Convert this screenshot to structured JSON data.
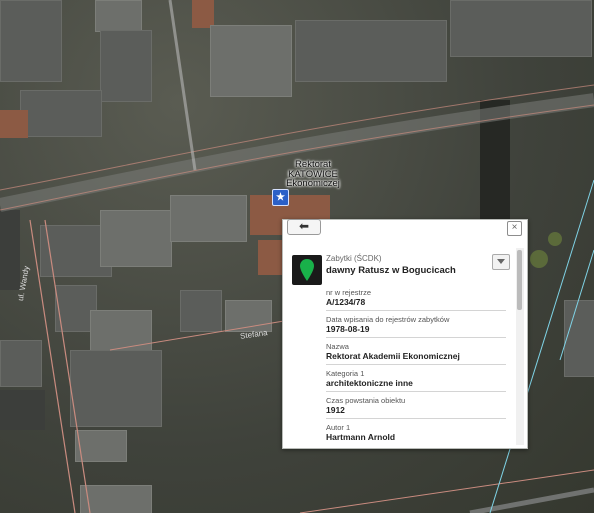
{
  "marker": {
    "label_line1": "Rektorat",
    "label_line2": "KATOWICE",
    "label_line3": "Ekonomiczej",
    "icon": "poi-icon"
  },
  "popup": {
    "category": "Zabytki (ŚCDK)",
    "title": "dawny Ratusz w Bogucicach",
    "fields": [
      {
        "label": "nr w rejestrze",
        "value": "A/1234/78"
      },
      {
        "label": "Data wpisania do rejestrów zabytków",
        "value": "1978-08-19"
      },
      {
        "label": "Nazwa",
        "value": "Rektorat Akademii Ekonomicznej"
      },
      {
        "label": "Kategoria 1",
        "value": "architektoniczne inne"
      },
      {
        "label": "Czas powstania obiektu",
        "value": "1912"
      },
      {
        "label": "Autor 1",
        "value": "Hartmann Arnold"
      }
    ],
    "icons": {
      "back": "back-arrow-icon",
      "close": "close-icon",
      "expand": "chevron-down-icon",
      "pin": "map-pin-icon"
    }
  },
  "streets": {
    "vertical": "ul. Wandy",
    "lower": "Stefana"
  }
}
